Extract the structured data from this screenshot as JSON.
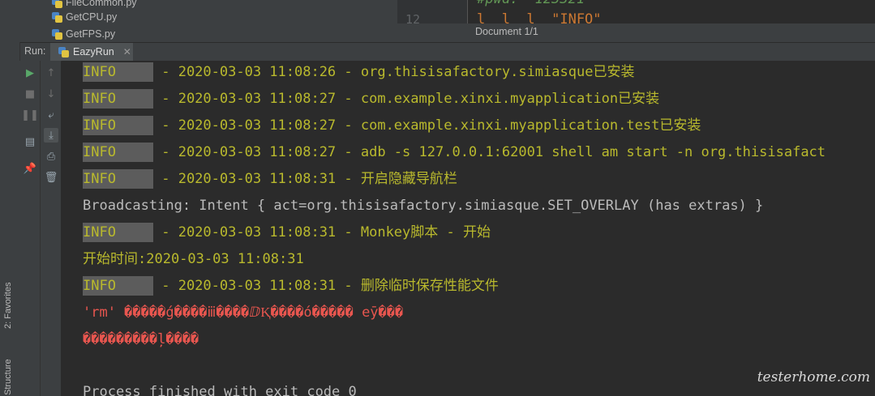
{
  "project_tree": {
    "items": [
      {
        "name": "FileCommon.py"
      },
      {
        "name": "GetCPU.py"
      },
      {
        "name": "GetFPS.py"
      }
    ]
  },
  "editor": {
    "line_number": "12",
    "line_top": "#pwd: '123321'",
    "line_bottom": "l  l  l  \"INFO\"",
    "status": "Document 1/1"
  },
  "run_panel": {
    "label": "Run:",
    "tab_name": "EazyRun"
  },
  "side_tabs": {
    "favorites": "2: Favorites",
    "structure": "Structure"
  },
  "console": {
    "log_lines": [
      {
        "level": "INFO",
        "text": " - 2020-03-03 11:08:26 - org.thisisafactory.simiasque已安装"
      },
      {
        "level": "INFO",
        "text": " - 2020-03-03 11:08:27 - com.example.xinxi.myapplication已安装"
      },
      {
        "level": "INFO",
        "text": " - 2020-03-03 11:08:27 - com.example.xinxi.myapplication.test已安装"
      },
      {
        "level": "INFO",
        "text": " - 2020-03-03 11:08:27 - adb -s 127.0.0.1:62001 shell am start -n org.thisisafact"
      },
      {
        "level": "INFO",
        "text": " - 2020-03-03 11:08:31 - 开启隐藏导航栏"
      }
    ],
    "broadcast_line": "Broadcasting: Intent { act=org.thisisafactory.simiasque.SET_OVERLAY (has extras) }",
    "monkey_line": {
      "level": "INFO",
      "text": " - 2020-03-03 11:08:31 - Monkey脚本 - 开始"
    },
    "start_time_line": "开始时间:2020-03-03 11:08:31",
    "delete_line": {
      "level": "INFO",
      "text": " - 2020-03-03 11:08:31 - 删除临时保存性能文件"
    },
    "error_line_1": "'rm' �����ǵ����ⅲ����ⅅⱩ����ó����� eȳ���",
    "error_line_2": "���������ļ����",
    "process_line": "Process finished with exit code 0"
  },
  "watermark": "testerhome.com",
  "colors": {
    "log_yellow": "#b9b92d",
    "level_bg": "#5c5c5c",
    "plain": "#bbbbbb",
    "error": "#e8564f"
  }
}
